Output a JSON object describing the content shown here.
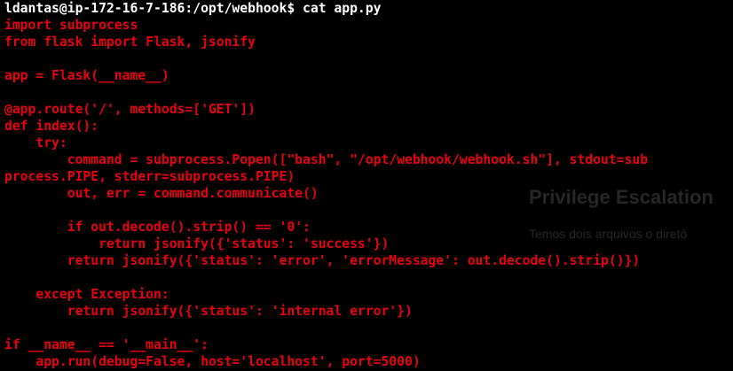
{
  "terminal": {
    "prompt": "ldantas@ip-172-16-7-186:/opt/webhook$ cat app.py",
    "lines": [
      "import subprocess",
      "from flask import Flask, jsonify",
      "",
      "app = Flask(__name__)",
      "",
      "@app.route('/', methods=['GET'])",
      "def index():",
      "    try:",
      "        command = subprocess.Popen([\"bash\", \"/opt/webhook/webhook.sh\"], stdout=sub",
      "process.PIPE, stderr=subprocess.PIPE)",
      "        out, err = command.communicate()",
      "",
      "        if out.decode().strip() == '0':",
      "            return jsonify({'status': 'success'})",
      "        return jsonify({'status': 'error', 'errorMessage': out.decode().strip()})",
      "",
      "    except Exception:",
      "        return jsonify({'status': 'internal error'})",
      "",
      "if __name__ == '__main__':",
      "    app.run(debug=False, host='localhost', port=5000)"
    ],
    "colors": {
      "background": "#000000",
      "prompt": "#ffffff",
      "code": "#e8000f"
    }
  },
  "background_window": {
    "heading": "Privilege Escalation",
    "text": "Temos dois arquivos o diretó"
  }
}
